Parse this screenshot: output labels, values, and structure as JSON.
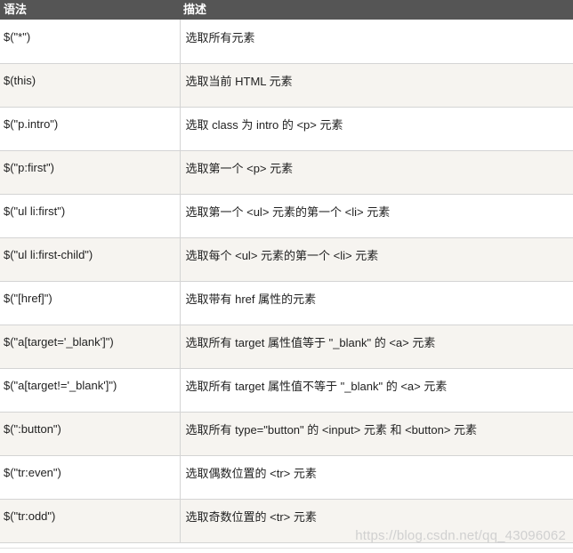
{
  "table": {
    "headers": {
      "syntax": "语法",
      "description": "描述"
    },
    "rows": [
      {
        "selector": "$(\"*\")",
        "description": "选取所有元素"
      },
      {
        "selector": "$(this)",
        "description": "选取当前 HTML 元素"
      },
      {
        "selector": "$(\"p.intro\")",
        "description": "选取 class 为 intro 的 <p> 元素"
      },
      {
        "selector": "$(\"p:first\")",
        "description": "选取第一个 <p> 元素"
      },
      {
        "selector": "$(\"ul li:first\")",
        "description": "选取第一个 <ul> 元素的第一个 <li> 元素"
      },
      {
        "selector": "$(\"ul li:first-child\")",
        "description": "选取每个 <ul> 元素的第一个 <li> 元素"
      },
      {
        "selector": "$(\"[href]\")",
        "description": "选取带有 href 属性的元素"
      },
      {
        "selector": "$(\"a[target='_blank']\")",
        "description": "选取所有 target 属性值等于 \"_blank\" 的 <a> 元素"
      },
      {
        "selector": "$(\"a[target!='_blank']\")",
        "description": "选取所有 target 属性值不等于 \"_blank\" 的 <a> 元素"
      },
      {
        "selector": "$(\":button\")",
        "description": "选取所有 type=\"button\" 的 <input> 元素 和 <button> 元素"
      },
      {
        "selector": "$(\"tr:even\")",
        "description": "选取偶数位置的 <tr> 元素"
      },
      {
        "selector": "$(\"tr:odd\")",
        "description": "选取奇数位置的 <tr> 元素"
      }
    ]
  },
  "watermark": "https://blog.csdn.net/qq_43096062"
}
